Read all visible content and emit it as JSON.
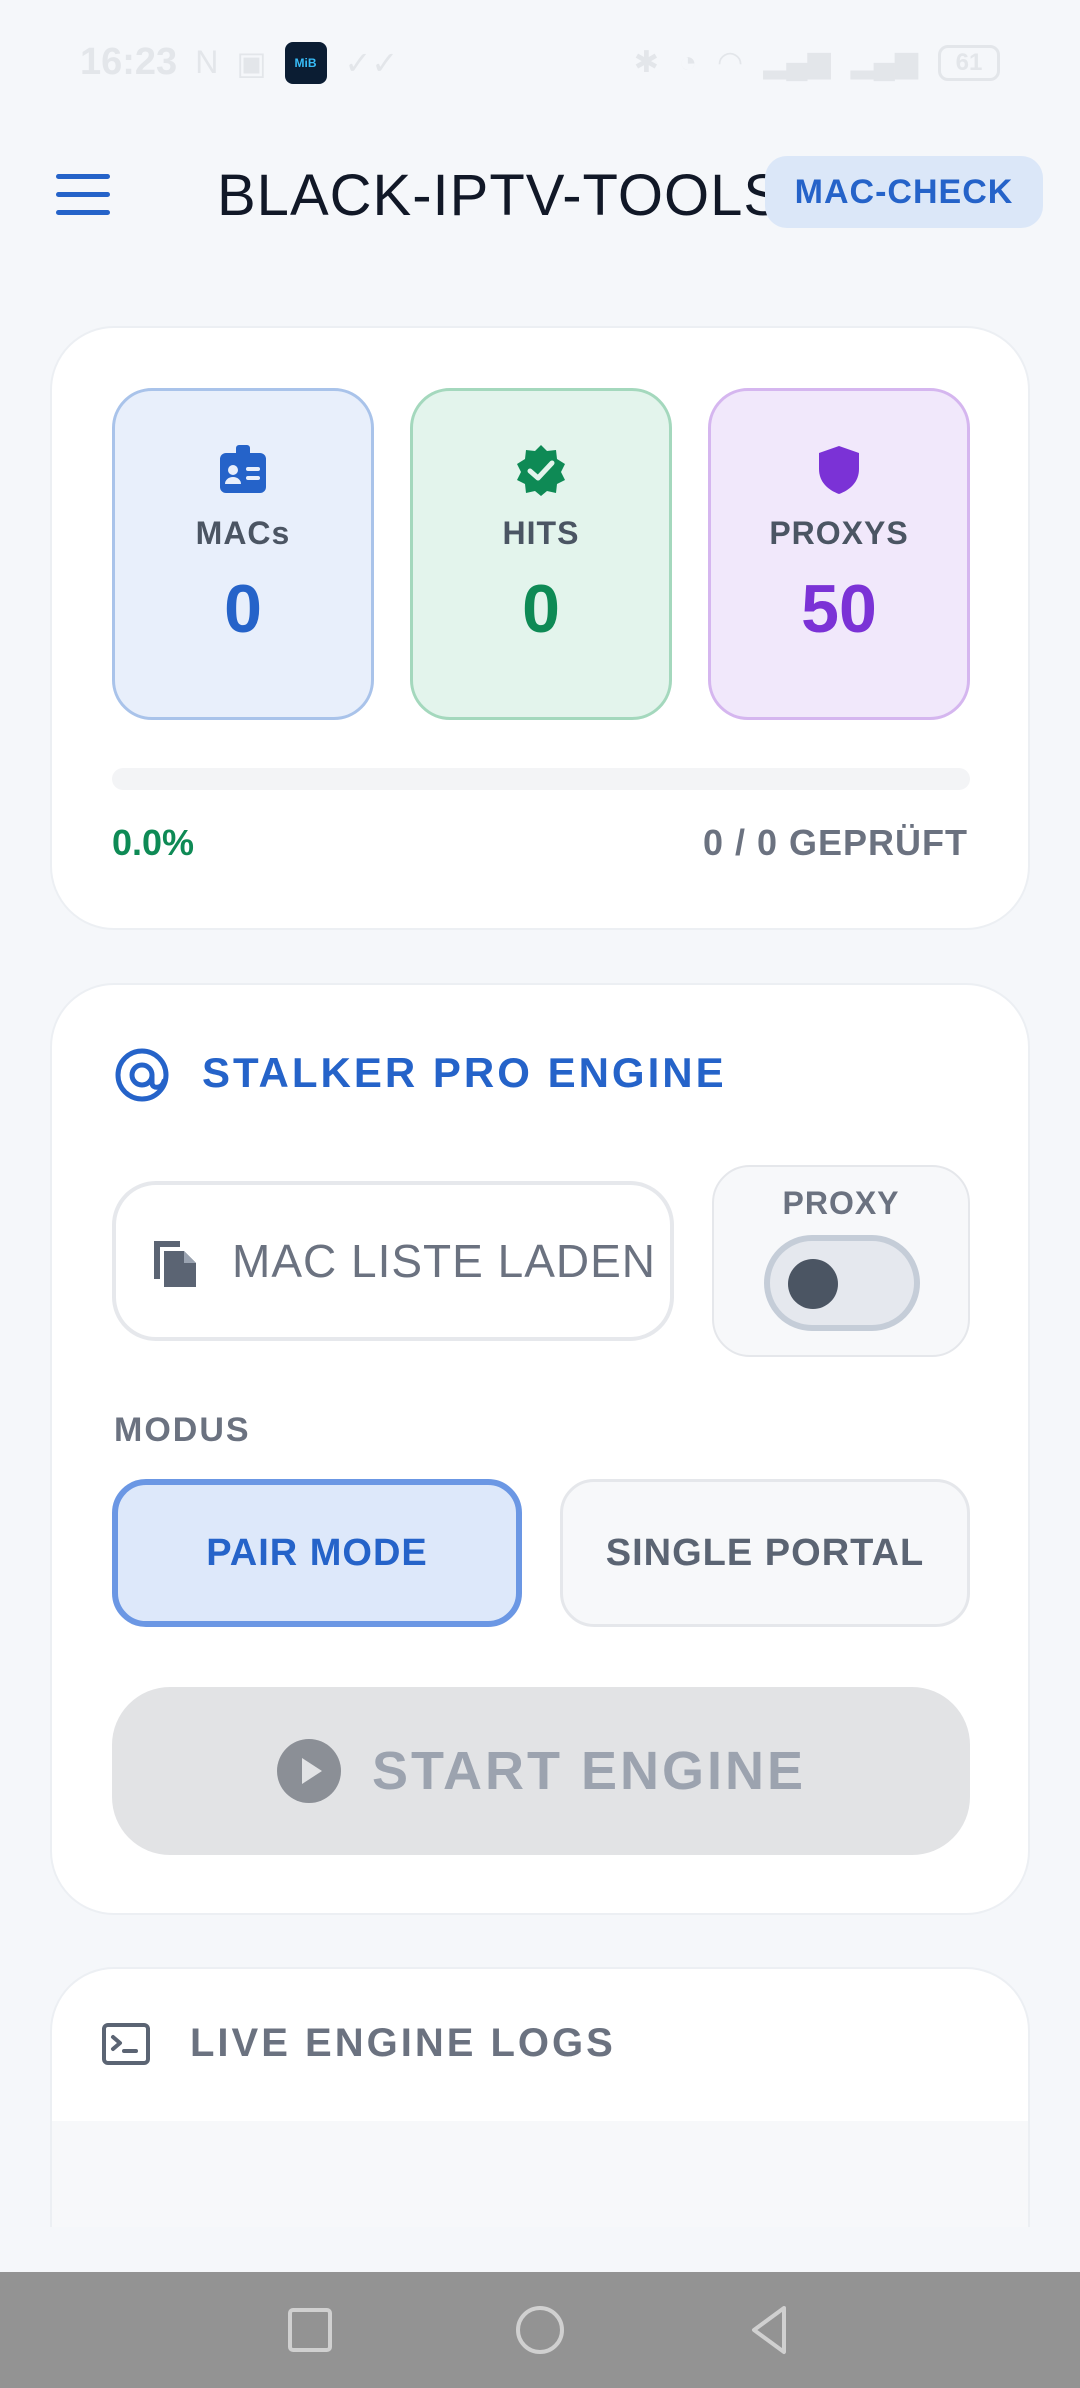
{
  "status_bar": {
    "time": "16:23",
    "battery": "61",
    "icons": [
      "nfc-icon",
      "photo-icon",
      "app-icon",
      "check-icon",
      "check-icon",
      "bluetooth-icon",
      "mute-icon",
      "wifi-icon",
      "signal-icon",
      "signal-icon",
      "battery-icon"
    ],
    "app_icon_text": "MiB"
  },
  "header": {
    "title": "BLACK-IPTV-TOOLS",
    "mac_check_label": "MAC-CHECK"
  },
  "stats": {
    "macs": {
      "label": "MACs",
      "value": "0",
      "icon": "id-badge-icon"
    },
    "hits": {
      "label": "HITS",
      "value": "0",
      "icon": "verified-check-icon"
    },
    "proxys": {
      "label": "PROXYS",
      "value": "50",
      "icon": "shield-icon"
    },
    "progress_percent": "0.0%",
    "progress_fraction": 0,
    "checked_text": "0 / 0 GEPRÜFT"
  },
  "engine": {
    "title": "STALKER PRO ENGINE",
    "load_label": "MAC LISTE LADEN",
    "proxy_label": "PROXY",
    "proxy_enabled": false,
    "modus_label": "MODUS",
    "modes": [
      "PAIR MODE",
      "SINGLE PORTAL"
    ],
    "selected_mode": "PAIR MODE",
    "start_label": "START ENGINE"
  },
  "logs": {
    "title": "LIVE ENGINE LOGS"
  },
  "colors": {
    "accent_blue": "#2563c9",
    "hits_green": "#0e8a55",
    "proxy_purple": "#7b32d6",
    "background": "#f5f7fa"
  }
}
